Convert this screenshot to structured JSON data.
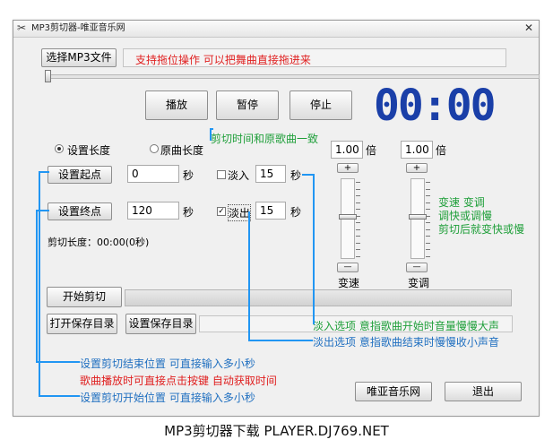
{
  "window": {
    "title": "MP3剪切器-唯亚音乐网"
  },
  "top": {
    "select_button": "选择MP3文件",
    "drag_hint": "支持拖位操作  可以把舞曲直接拖进来"
  },
  "transport": {
    "play": "播放",
    "pause": "暂停",
    "stop": "停止",
    "time": "00:00"
  },
  "mode": {
    "option_set_length": "设置长度",
    "option_original": "原曲长度",
    "note": "剪切时间和原歌曲一致"
  },
  "start": {
    "button": "设置起点",
    "value": "0",
    "unit": "秒",
    "fadein_label": "淡入",
    "fadein_value": "15",
    "fadein_unit": "秒",
    "fadein_checked": false
  },
  "end": {
    "button": "设置终点",
    "value": "120",
    "unit": "秒",
    "fadeout_label": "淡出",
    "fadeout_value": "15",
    "fadeout_unit": "秒",
    "fadeout_checked": true
  },
  "cut_length": "剪切长度：00:00(0秒)",
  "speed": {
    "value": "1.00",
    "unit": "倍",
    "plus": "+",
    "minus": "—",
    "label": "变速"
  },
  "pitch": {
    "value": "1.00",
    "unit": "倍",
    "plus": "+",
    "minus": "—",
    "label": "变调"
  },
  "speed_note": [
    "变速 变调",
    "调快或调慢",
    "剪切后就变快或慢"
  ],
  "actions": {
    "start_cut": "开始剪切",
    "open_save_dir": "打开保存目录",
    "set_save_dir": "设置保存目录",
    "site": "唯亚音乐网",
    "exit": "退出"
  },
  "notes": {
    "fadein": "淡入选项   意指歌曲开始时音量慢慢大声",
    "fadeout": "淡出选项   意指歌曲结束时慢慢收小声音",
    "end_point": "设置剪切结束位置   可直接输入多小秒",
    "auto_get": "歌曲播放时可直接点击按键  自动获取时间",
    "start_point": "设置剪切开始位置   可直接输入多小秒"
  },
  "caption": "MP3剪切器下载    PLAYER.DJ769.NET",
  "colors": {
    "annotation_line": "#2196f3",
    "green_note": "#1f9f3a",
    "red_note": "#e02020",
    "blue_note": "#1f6fc0",
    "lcd": "#1a3fa8"
  }
}
